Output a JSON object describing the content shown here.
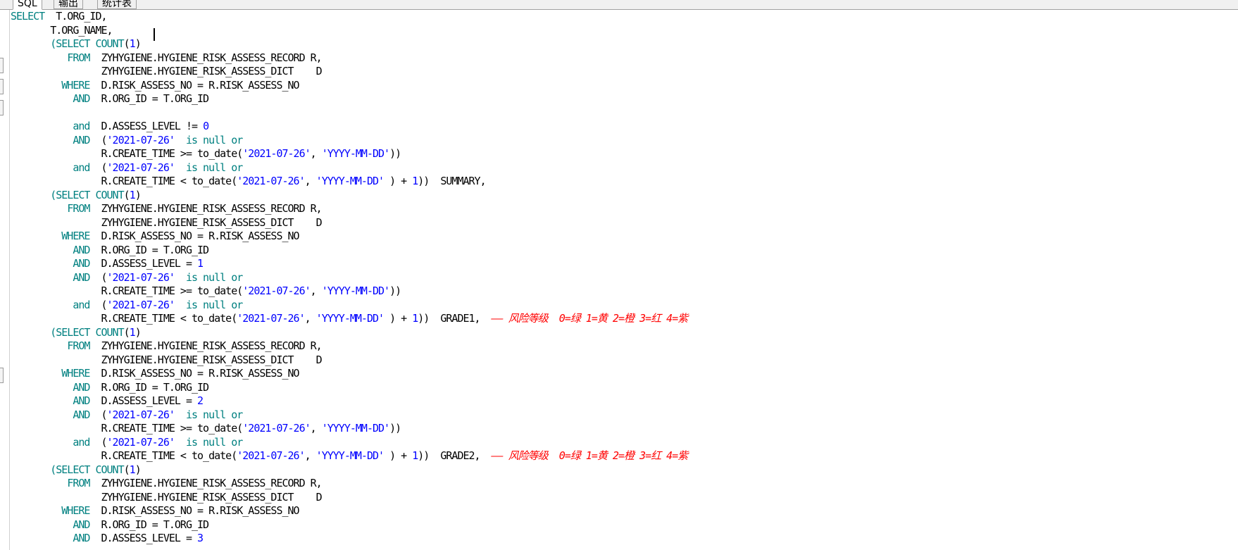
{
  "tabs": [
    {
      "label": "SQL",
      "active": true
    },
    {
      "label": "输出",
      "active": false
    },
    {
      "label": "统计表",
      "active": false
    }
  ],
  "editor": {
    "lines": [
      [
        [
          "kw",
          "SELECT"
        ],
        [
          "",
          "  T.ORG_ID,"
        ]
      ],
      [
        [
          "",
          "       T.ORG_NAME,"
        ]
      ],
      [
        [
          "",
          "       "
        ],
        [
          "kw",
          "(SELECT COUNT"
        ],
        [
          "",
          "("
        ],
        [
          "num",
          "1"
        ],
        [
          "",
          ")"
        ]
      ],
      [
        [
          "",
          "          "
        ],
        [
          "kw",
          "FROM"
        ],
        [
          "",
          "  ZYHYGIENE.HYGIENE_RISK_ASSESS_RECORD R,"
        ]
      ],
      [
        [
          "",
          "                ZYHYGIENE.HYGIENE_RISK_ASSESS_DICT    D"
        ]
      ],
      [
        [
          "",
          "         "
        ],
        [
          "kw",
          "WHERE"
        ],
        [
          "",
          "  D.RISK_ASSESS_NO = R.RISK_ASSESS_NO"
        ]
      ],
      [
        [
          "",
          "           "
        ],
        [
          "kw",
          "AND"
        ],
        [
          "",
          "  R.ORG_ID = T.ORG_ID"
        ]
      ],
      [
        [
          "",
          ""
        ]
      ],
      [
        [
          "",
          "           "
        ],
        [
          "kw",
          "and"
        ],
        [
          "",
          "  D.ASSESS_LEVEL != "
        ],
        [
          "num",
          "0"
        ]
      ],
      [
        [
          "",
          "           "
        ],
        [
          "kw",
          "AND"
        ],
        [
          "",
          "  ("
        ],
        [
          "str",
          "'2021-07-26'"
        ],
        [
          "",
          "  "
        ],
        [
          "kw",
          "is null or"
        ]
      ],
      [
        [
          "",
          "                R.CREATE_TIME >= to_date("
        ],
        [
          "str",
          "'2021-07-26'"
        ],
        [
          "",
          ", "
        ],
        [
          "str",
          "'YYYY-MM-DD'"
        ],
        [
          "",
          "))"
        ]
      ],
      [
        [
          "",
          "           "
        ],
        [
          "kw",
          "and"
        ],
        [
          "",
          "  ("
        ],
        [
          "str",
          "'2021-07-26'"
        ],
        [
          "",
          "  "
        ],
        [
          "kw",
          "is null or"
        ]
      ],
      [
        [
          "",
          "                R.CREATE_TIME < to_date("
        ],
        [
          "str",
          "'2021-07-26'"
        ],
        [
          "",
          ", "
        ],
        [
          "str",
          "'YYYY-MM-DD'"
        ],
        [
          "",
          " ) + "
        ],
        [
          "num",
          "1"
        ],
        [
          "",
          "))  SUMMARY,"
        ]
      ],
      [
        [
          "",
          "       "
        ],
        [
          "kw",
          "(SELECT COUNT"
        ],
        [
          "",
          "("
        ],
        [
          "num",
          "1"
        ],
        [
          "",
          ")"
        ]
      ],
      [
        [
          "",
          "          "
        ],
        [
          "kw",
          "FROM"
        ],
        [
          "",
          "  ZYHYGIENE.HYGIENE_RISK_ASSESS_RECORD R,"
        ]
      ],
      [
        [
          "",
          "                ZYHYGIENE.HYGIENE_RISK_ASSESS_DICT    D"
        ]
      ],
      [
        [
          "",
          "         "
        ],
        [
          "kw",
          "WHERE"
        ],
        [
          "",
          "  D.RISK_ASSESS_NO = R.RISK_ASSESS_NO"
        ]
      ],
      [
        [
          "",
          "           "
        ],
        [
          "kw",
          "AND"
        ],
        [
          "",
          "  R.ORG_ID = T.ORG_ID"
        ]
      ],
      [
        [
          "",
          "           "
        ],
        [
          "kw",
          "AND"
        ],
        [
          "",
          "  D.ASSESS_LEVEL = "
        ],
        [
          "num",
          "1"
        ]
      ],
      [
        [
          "",
          "           "
        ],
        [
          "kw",
          "AND"
        ],
        [
          "",
          "  ("
        ],
        [
          "str",
          "'2021-07-26'"
        ],
        [
          "",
          "  "
        ],
        [
          "kw",
          "is null or"
        ]
      ],
      [
        [
          "",
          "                R.CREATE_TIME >= to_date("
        ],
        [
          "str",
          "'2021-07-26'"
        ],
        [
          "",
          ", "
        ],
        [
          "str",
          "'YYYY-MM-DD'"
        ],
        [
          "",
          "))"
        ]
      ],
      [
        [
          "",
          "           "
        ],
        [
          "kw",
          "and"
        ],
        [
          "",
          "  ("
        ],
        [
          "str",
          "'2021-07-26'"
        ],
        [
          "",
          "  "
        ],
        [
          "kw",
          "is null or"
        ]
      ],
      [
        [
          "",
          "                R.CREATE_TIME < to_date("
        ],
        [
          "str",
          "'2021-07-26'"
        ],
        [
          "",
          ", "
        ],
        [
          "str",
          "'YYYY-MM-DD'"
        ],
        [
          "",
          " ) + "
        ],
        [
          "num",
          "1"
        ],
        [
          "",
          "))  GRADE1,  "
        ],
        [
          "cmt",
          "—— 风险等级  0=绿 1=黄 2=橙 3=红 4=紫"
        ]
      ],
      [
        [
          "",
          "       "
        ],
        [
          "kw",
          "(SELECT COUNT"
        ],
        [
          "",
          "("
        ],
        [
          "num",
          "1"
        ],
        [
          "",
          ")"
        ]
      ],
      [
        [
          "",
          "          "
        ],
        [
          "kw",
          "FROM"
        ],
        [
          "",
          "  ZYHYGIENE.HYGIENE_RISK_ASSESS_RECORD R,"
        ]
      ],
      [
        [
          "",
          "                ZYHYGIENE.HYGIENE_RISK_ASSESS_DICT    D"
        ]
      ],
      [
        [
          "",
          "         "
        ],
        [
          "kw",
          "WHERE"
        ],
        [
          "",
          "  D.RISK_ASSESS_NO = R.RISK_ASSESS_NO"
        ]
      ],
      [
        [
          "",
          "           "
        ],
        [
          "kw",
          "AND"
        ],
        [
          "",
          "  R.ORG_ID = T.ORG_ID"
        ]
      ],
      [
        [
          "",
          "           "
        ],
        [
          "kw",
          "AND"
        ],
        [
          "",
          "  D.ASSESS_LEVEL = "
        ],
        [
          "num",
          "2"
        ]
      ],
      [
        [
          "",
          "           "
        ],
        [
          "kw",
          "AND"
        ],
        [
          "",
          "  ("
        ],
        [
          "str",
          "'2021-07-26'"
        ],
        [
          "",
          "  "
        ],
        [
          "kw",
          "is null or"
        ]
      ],
      [
        [
          "",
          "                R.CREATE_TIME >= to_date("
        ],
        [
          "str",
          "'2021-07-26'"
        ],
        [
          "",
          ", "
        ],
        [
          "str",
          "'YYYY-MM-DD'"
        ],
        [
          "",
          "))"
        ]
      ],
      [
        [
          "",
          "           "
        ],
        [
          "kw",
          "and"
        ],
        [
          "",
          "  ("
        ],
        [
          "str",
          "'2021-07-26'"
        ],
        [
          "",
          "  "
        ],
        [
          "kw",
          "is null or"
        ]
      ],
      [
        [
          "",
          "                R.CREATE_TIME < to_date("
        ],
        [
          "str",
          "'2021-07-26'"
        ],
        [
          "",
          ", "
        ],
        [
          "str",
          "'YYYY-MM-DD'"
        ],
        [
          "",
          " ) + "
        ],
        [
          "num",
          "1"
        ],
        [
          "",
          "))  GRADE2,  "
        ],
        [
          "cmt",
          "—— 风险等级  0=绿 1=黄 2=橙 3=红 4=紫"
        ]
      ],
      [
        [
          "",
          "       "
        ],
        [
          "kw",
          "(SELECT COUNT"
        ],
        [
          "",
          "("
        ],
        [
          "num",
          "1"
        ],
        [
          "",
          ")"
        ]
      ],
      [
        [
          "",
          "          "
        ],
        [
          "kw",
          "FROM"
        ],
        [
          "",
          "  ZYHYGIENE.HYGIENE_RISK_ASSESS_RECORD R,"
        ]
      ],
      [
        [
          "",
          "                ZYHYGIENE.HYGIENE_RISK_ASSESS_DICT    D"
        ]
      ],
      [
        [
          "",
          "         "
        ],
        [
          "kw",
          "WHERE"
        ],
        [
          "",
          "  D.RISK_ASSESS_NO = R.RISK_ASSESS_NO"
        ]
      ],
      [
        [
          "",
          "           "
        ],
        [
          "kw",
          "AND"
        ],
        [
          "",
          "  R.ORG_ID = T.ORG_ID"
        ]
      ],
      [
        [
          "",
          "           "
        ],
        [
          "kw",
          "AND"
        ],
        [
          "",
          "  D.ASSESS_LEVEL = "
        ],
        [
          "num",
          "3"
        ]
      ]
    ]
  }
}
